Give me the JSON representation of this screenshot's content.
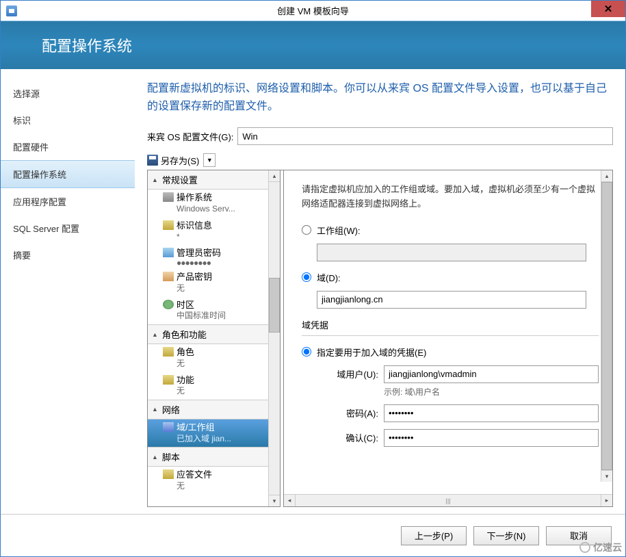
{
  "titlebar": {
    "title": "创建 VM 模板向导"
  },
  "header": {
    "title": "配置操作系统"
  },
  "nav": {
    "items": [
      {
        "label": "选择源"
      },
      {
        "label": "标识"
      },
      {
        "label": "配置硬件"
      },
      {
        "label": "配置操作系统"
      },
      {
        "label": "应用程序配置"
      },
      {
        "label": "SQL Server 配置"
      },
      {
        "label": "摘要"
      }
    ],
    "selectedIndex": 3
  },
  "content": {
    "instruction": "配置新虚拟机的标识、网络设置和脚本。你可以从来宾 OS 配置文件导入设置，也可以基于自己的设置保存新的配置文件。",
    "profile_label": "来宾 OS 配置文件(G):",
    "profile_value": "Win",
    "saveas_label": "另存为(S)"
  },
  "tree": {
    "sections": [
      {
        "label": "常规设置",
        "items": [
          {
            "label": "操作系统",
            "sub": "Windows Serv..."
          },
          {
            "label": "标识信息",
            "sub": "*"
          },
          {
            "label": "管理员密码",
            "dots": true
          },
          {
            "label": "产品密钥",
            "sub": "无"
          },
          {
            "label": "时区",
            "sub": "中国标准时间"
          }
        ]
      },
      {
        "label": "角色和功能",
        "items": [
          {
            "label": "角色",
            "sub": "无"
          },
          {
            "label": "功能",
            "sub": "无"
          }
        ]
      },
      {
        "label": "网络",
        "items": [
          {
            "label": "域/工作组",
            "sub": "已加入域 jian...",
            "sel": true
          }
        ]
      },
      {
        "label": "脚本",
        "items": [
          {
            "label": "应答文件",
            "sub": "无"
          }
        ]
      }
    ]
  },
  "details": {
    "instruction": "请指定虚拟机应加入的工作组或域。要加入域，虚拟机必须至少有一个虚拟网络适配器连接到虚拟网络上。",
    "workgroup_label": "工作组(W):",
    "workgroup_value": "",
    "domain_label": "域(D):",
    "domain_value": "jiangjianlong.cn",
    "cred_section": "域凭据",
    "cred_radio": "指定要用于加入域的凭据(E)",
    "user_label": "域用户(U):",
    "user_value": "jiangjianlong\\vmadmin",
    "user_hint": "示例: 域\\用户名",
    "pass_label": "密码(A):",
    "pass_value": "••••••••",
    "confirm_label": "确认(C):",
    "confirm_value": "••••••••"
  },
  "footer": {
    "prev": "上一步(P)",
    "next": "下一步(N)",
    "cancel": "取消"
  },
  "watermark": "亿速云"
}
